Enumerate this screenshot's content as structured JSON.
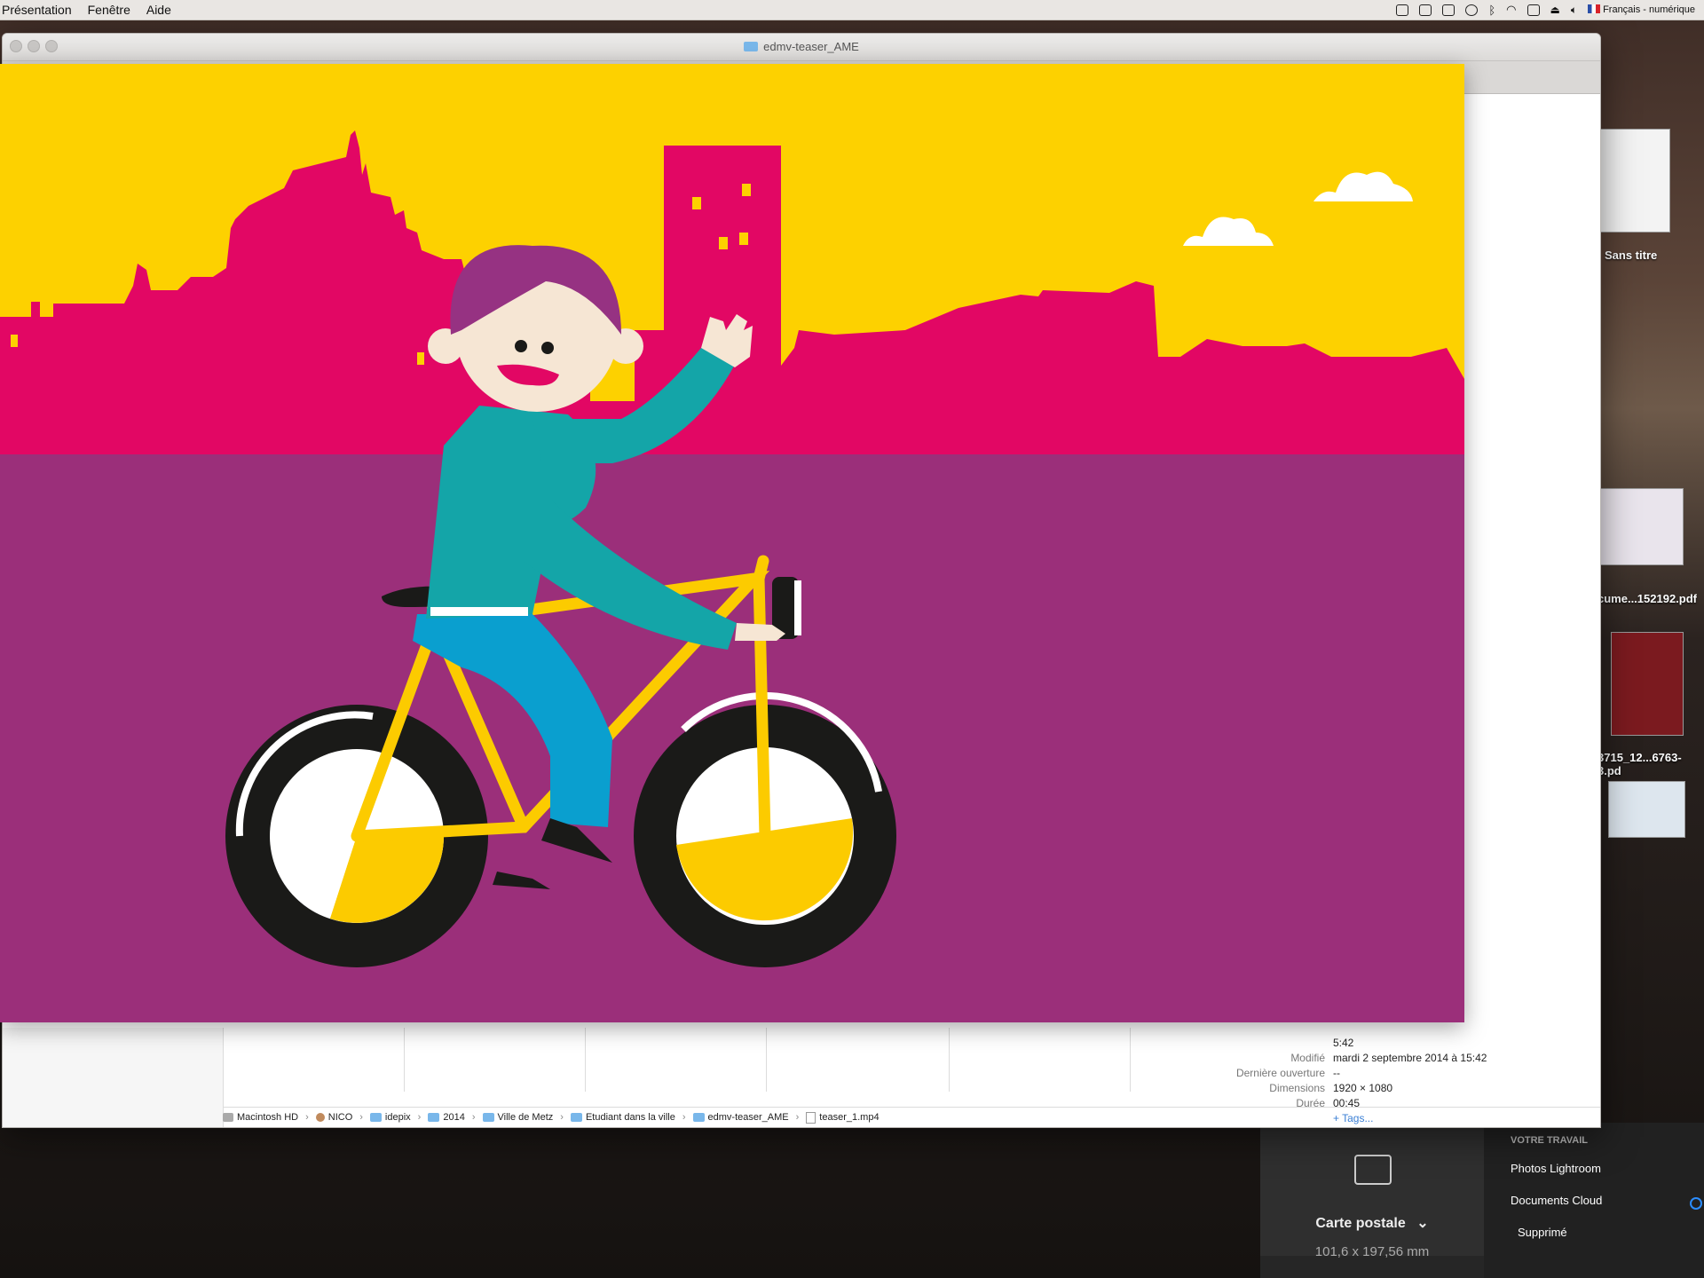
{
  "menubar": {
    "items": [
      "Présentation",
      "Fenêtre",
      "Aide"
    ],
    "input_source": "Français - numérique"
  },
  "finder": {
    "title": "edmv-teaser_AME",
    "info": [
      {
        "key": "",
        "value": "5:42"
      },
      {
        "key": "Modifié",
        "value": "mardi 2 septembre 2014 à 15:42"
      },
      {
        "key": "Dernière ouverture",
        "value": "--"
      },
      {
        "key": "Dimensions",
        "value": "1920 × 1080"
      },
      {
        "key": "Durée",
        "value": "00:45"
      }
    ],
    "tags_link": "+ Tags...",
    "path": [
      "Macintosh HD",
      "NICO",
      "idepix",
      "2014",
      "Ville de Metz",
      "Etudiant dans la ville",
      "edmv-teaser_AME",
      "teaser_1.mp4"
    ]
  },
  "desktop": {
    "items": [
      {
        "label": "Sans titre",
        "icon": "document-icon"
      },
      {
        "label": "cume...152192.pdf",
        "icon": "pdf-icon"
      },
      {
        "label": "3715_12...6763-3.pd",
        "icon": "pdf-icon"
      }
    ]
  },
  "print_panel": {
    "paper_name": "Carte postale",
    "paper_size": "101,6 x 197,56 mm"
  },
  "cloud_panel": {
    "heading": "VOTRE TRAVAIL",
    "items": [
      "Photos Lightroom",
      "Documents Cloud",
      "Supprimé"
    ]
  },
  "colors": {
    "sky": "#fdd100",
    "city": "#e20764",
    "ground": "#9b2f7a",
    "shirt": "#14a5a8",
    "jeans": "#0a9fcf",
    "hair": "#963282",
    "bike": "#fccb00"
  }
}
